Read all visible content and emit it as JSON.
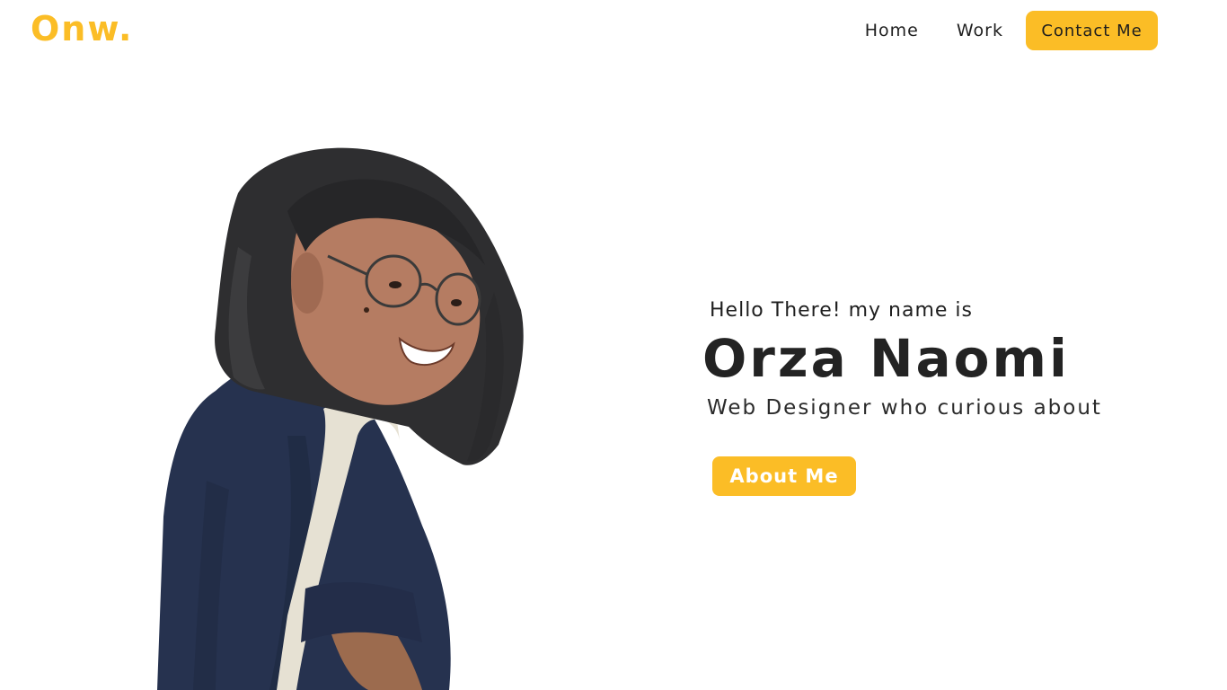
{
  "brand": {
    "logo_text": "Onw.",
    "accent_color": "#fbbd26"
  },
  "nav": {
    "home_label": "Home",
    "work_label": "Work",
    "contact_label": "Contact Me"
  },
  "hero": {
    "greeting": "Hello There! my name is",
    "name": "Orza Naomi",
    "role": "Web Designer who curious about",
    "about_button_label": "About Me",
    "portrait_icon": "person-photo"
  }
}
